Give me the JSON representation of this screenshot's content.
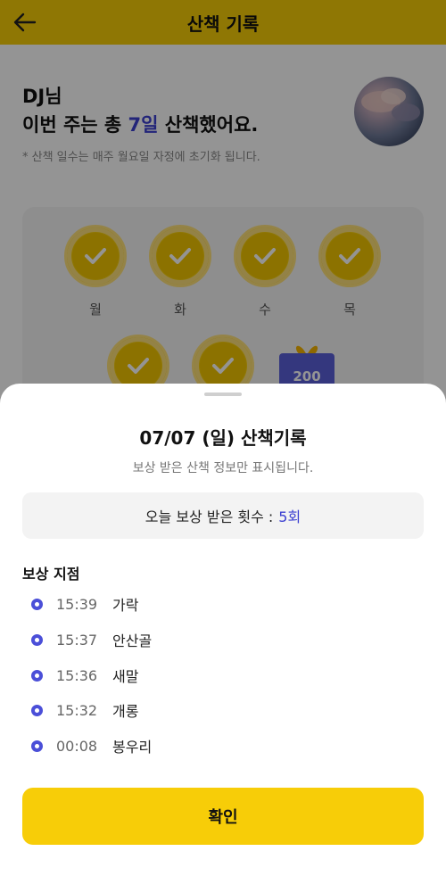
{
  "header": {
    "title": "산책 기록",
    "back_icon": "arrow-left-icon"
  },
  "summary": {
    "name": "DJ님",
    "line_prefix": "이번 주는 총 ",
    "days": "7일",
    "line_suffix": " 산책했어요.",
    "note": "* 산책 일수는 매주 월요일 자정에 초기화 됩니다."
  },
  "week": {
    "days": [
      {
        "label": "월",
        "checked": true
      },
      {
        "label": "화",
        "checked": true
      },
      {
        "label": "수",
        "checked": true
      },
      {
        "label": "목",
        "checked": true
      },
      {
        "label": "",
        "checked": true
      },
      {
        "label": "",
        "checked": true
      }
    ],
    "gift_value": "200"
  },
  "sheet": {
    "title": "07/07 (일) 산책기록",
    "subtitle": "보상 받은 산책 정보만 표시됩니다.",
    "count_label": "오늘 보상 받은 횟수 :",
    "count_value": "5회",
    "points_heading": "보상 지점",
    "points": [
      {
        "time": "15:39",
        "place": "가락"
      },
      {
        "time": "15:37",
        "place": "안산골"
      },
      {
        "time": "15:36",
        "place": "새말"
      },
      {
        "time": "15:32",
        "place": "개롱"
      },
      {
        "time": "00:08",
        "place": "봉우리"
      }
    ],
    "confirm_label": "확인"
  },
  "colors": {
    "brand": "#f7cd08",
    "accent": "#3b3fd1"
  }
}
